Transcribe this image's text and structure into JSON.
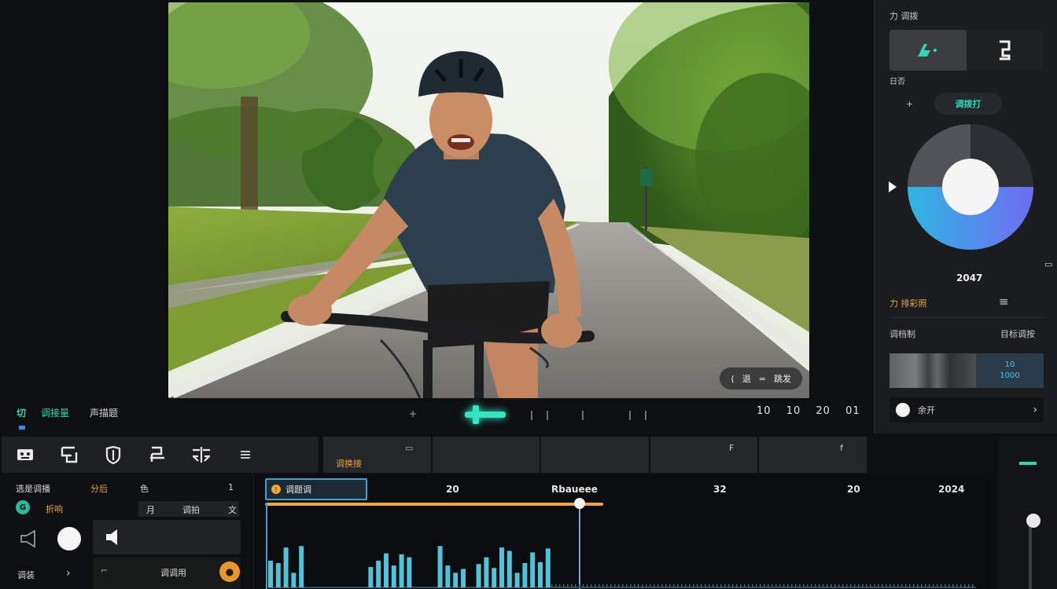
{
  "preview": {
    "overlay_chip": {
      "left": "(",
      "mid": "退",
      "right": "跳发"
    }
  },
  "inspector": {
    "header": "力 调拨",
    "section_label": "日否",
    "add_label": "+",
    "pill_label": "调拨打",
    "wheel": {
      "value": "2047",
      "fraction_blue": 0.5,
      "colors": {
        "dark": "#2c2f33",
        "gray": "#505458",
        "blue_start": "#2fb6e3",
        "blue_end": "#6e6cf0"
      }
    },
    "adjust_title": "力 排彩照",
    "adjust_icon": "≡",
    "row_label_left": "调档制",
    "row_label_right": "目标调按",
    "swatch_right_line1": "10",
    "swatch_right_line2": "1000",
    "bottom_label": "余开",
    "bottom_icon": "›"
  },
  "transport": {
    "tab_a": "切",
    "tab_b": "调接量",
    "tab_c": "声描题",
    "time_readout": [
      "10",
      "10",
      "20",
      "01"
    ]
  },
  "toolbar": {
    "icons": [
      "face-icon",
      "split-icon",
      "shield-icon",
      "crop-icon",
      "mirror-icon",
      "menu-icon"
    ]
  },
  "tracks": {
    "title": "调换接",
    "cells": [
      "",
      "",
      "",
      "F",
      "f"
    ]
  },
  "props": {
    "title": "选是调播",
    "title_accent": "分后",
    "col_a": "色",
    "col_b": "1",
    "item_accent": "折响",
    "tag_a": "月",
    "tag_b": "调拍",
    "tag_c": "文",
    "bottom_left": "调装",
    "bottom_arrow": "›",
    "panel2_label": "调调用"
  },
  "timeline": {
    "clip_label": "调题调",
    "ruler": [
      "20",
      "Rbaueee",
      "32",
      "20",
      "2024"
    ],
    "playhead_fraction": 0.42,
    "waveform": [
      0.55,
      0.5,
      0.82,
      0.3,
      0.85,
      0,
      0,
      0,
      0,
      0,
      0,
      0,
      0,
      0.42,
      0.55,
      0.7,
      0.45,
      0.68,
      0.62,
      0,
      0,
      0,
      0.85,
      0.45,
      0.3,
      0.38,
      0,
      0.48,
      0.62,
      0.4,
      0.82,
      0.75,
      0.3,
      0.5,
      0.72,
      0.52,
      0.8
    ]
  }
}
